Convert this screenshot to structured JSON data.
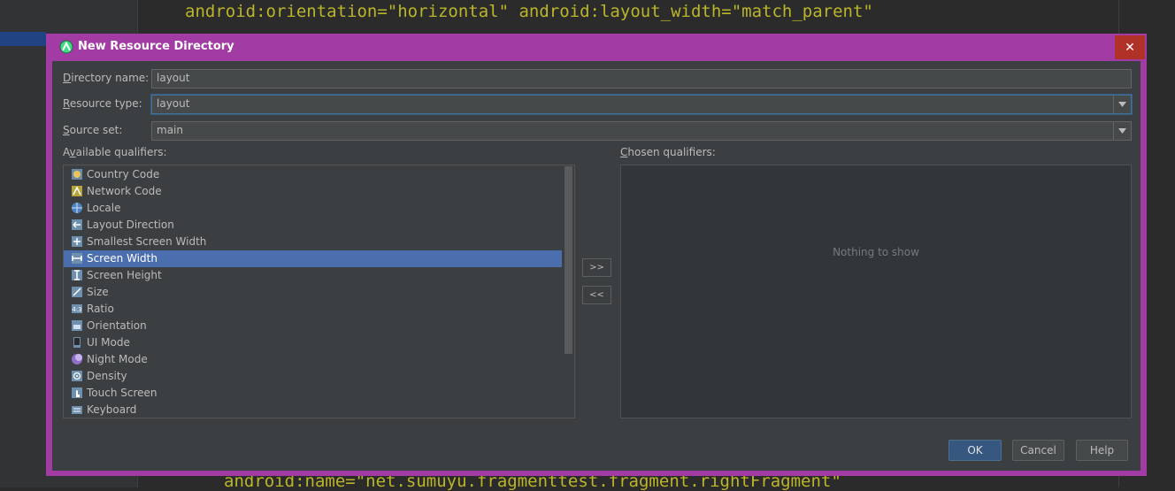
{
  "editor": {
    "code_top": "android:orientation=\"horizontal\" android:layout_width=\"match_parent\"",
    "code_bottom": "android:name=\"net.sumuyu.fragmenttest.fragment.rightFragment\""
  },
  "dialog": {
    "title": "New Resource Directory",
    "close_label": "✕",
    "directory_name": {
      "label_mn": "D",
      "label_rest": "irectory name:",
      "value": "layout"
    },
    "resource_type": {
      "label_mn": "R",
      "label_rest": "esource type:",
      "value": "layout"
    },
    "source_set": {
      "label_mn": "S",
      "label_rest": "ource set:",
      "value": "main"
    },
    "available_label": {
      "pre": "A",
      "mn": "v",
      "rest": "ailable qualifiers:"
    },
    "chosen_label": {
      "mn": "C",
      "rest": "hosen qualifiers:"
    },
    "qualifiers": [
      {
        "label": "Country Code",
        "icon": "country-code-icon"
      },
      {
        "label": "Network Code",
        "icon": "network-code-icon"
      },
      {
        "label": "Locale",
        "icon": "globe-icon"
      },
      {
        "label": "Layout Direction",
        "icon": "layout-direction-icon"
      },
      {
        "label": "Smallest Screen Width",
        "icon": "smallest-width-icon"
      },
      {
        "label": "Screen Width",
        "icon": "screen-width-icon",
        "selected": true
      },
      {
        "label": "Screen Height",
        "icon": "screen-height-icon"
      },
      {
        "label": "Size",
        "icon": "size-icon"
      },
      {
        "label": "Ratio",
        "icon": "ratio-icon"
      },
      {
        "label": "Orientation",
        "icon": "orientation-icon"
      },
      {
        "label": "UI Mode",
        "icon": "ui-mode-icon"
      },
      {
        "label": "Night Mode",
        "icon": "night-mode-icon"
      },
      {
        "label": "Density",
        "icon": "density-icon"
      },
      {
        "label": "Touch Screen",
        "icon": "touch-screen-icon"
      },
      {
        "label": "Keyboard",
        "icon": "keyboard-icon"
      }
    ],
    "add_label": ">>",
    "remove_label": "<<",
    "empty_text": "Nothing to show",
    "ok_label": "OK",
    "cancel_label": "Cancel",
    "help_label": "Help"
  },
  "colors": {
    "dialog_border": "#a23ba3",
    "selection": "#4b6eaf",
    "code_text": "#bbb529"
  }
}
